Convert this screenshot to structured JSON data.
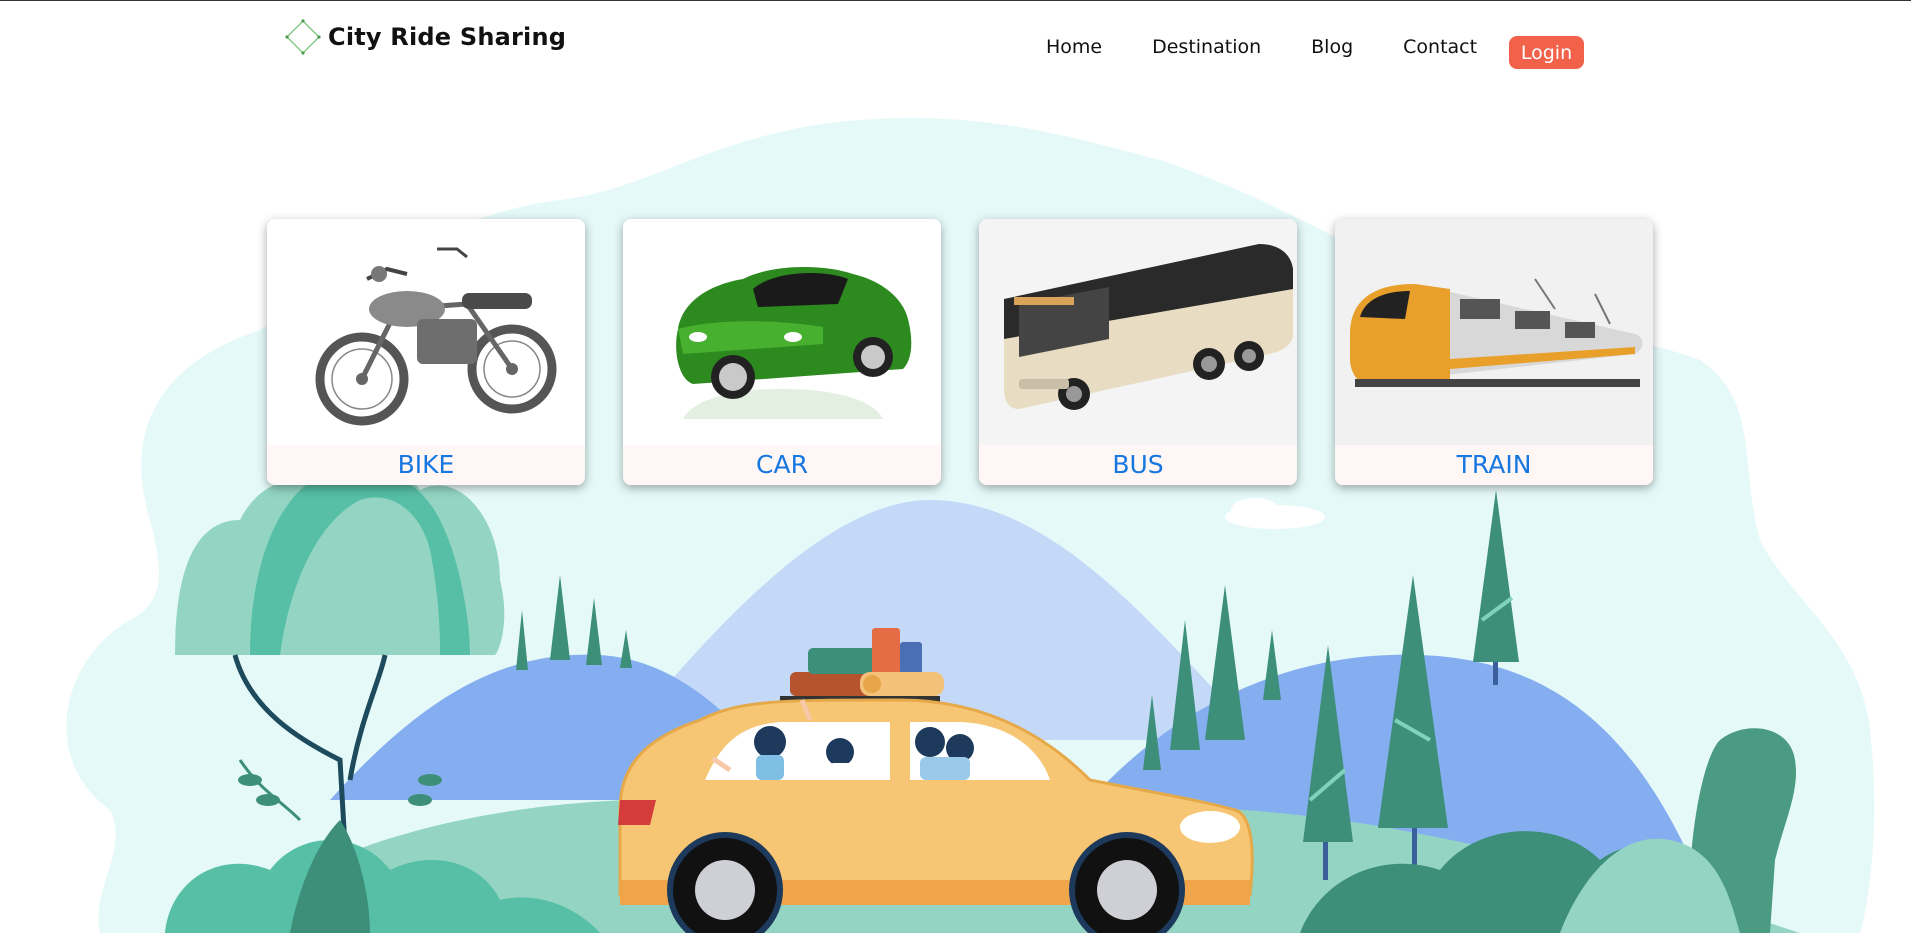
{
  "brand": {
    "name": "City Ride Sharing",
    "logo_icon": "diamond-logo-icon"
  },
  "nav": {
    "items": [
      {
        "label": "Home"
      },
      {
        "label": "Destination"
      },
      {
        "label": "Blog"
      },
      {
        "label": "Contact"
      }
    ],
    "login_label": "Login"
  },
  "vehicles": [
    {
      "label": "BIKE",
      "icon": "motorcycle-image"
    },
    {
      "label": "CAR",
      "icon": "car-image"
    },
    {
      "label": "BUS",
      "icon": "bus-image"
    },
    {
      "label": "TRAIN",
      "icon": "train-image"
    }
  ],
  "colors": {
    "accent": "#f2614a",
    "card_label": "#1677e0",
    "sky_blob": "#e6f9f9",
    "mountain_light": "#c4d9f7",
    "mountain_dark": "#85aef0",
    "tree_dark": "#3d8f7a",
    "tree_light": "#93d5c2",
    "taxi": "#f6c674"
  }
}
